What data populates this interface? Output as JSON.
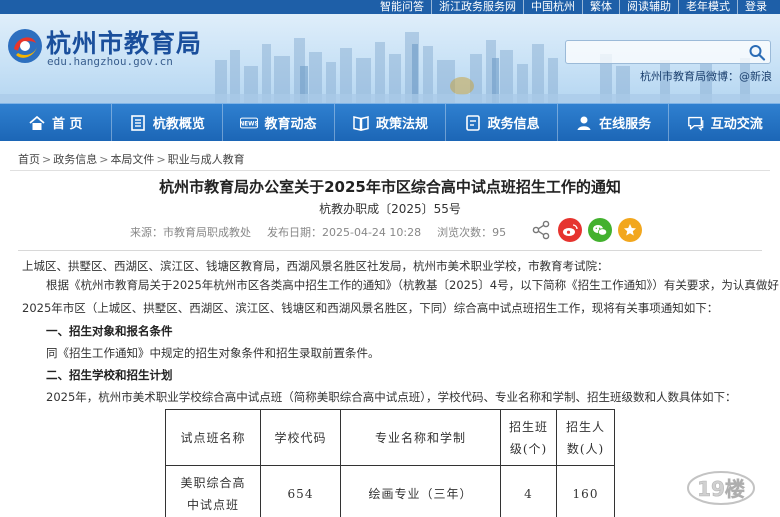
{
  "util_bar": {
    "links": [
      "智能问答",
      "浙江政务服务网",
      "中国杭州",
      "繁体",
      "阅读辅助",
      "老年模式",
      "登录"
    ]
  },
  "header": {
    "site_title": "杭州市教育局",
    "domain": "edu.hangzhou.gov.cn",
    "search_placeholder": "",
    "weibo_text": "杭州市教育局微博：@新浪"
  },
  "nav": {
    "items": [
      {
        "label": "首 页",
        "icon": "home-icon"
      },
      {
        "label": "杭教概览",
        "icon": "document-list-icon"
      },
      {
        "label": "教育动态",
        "icon": "news-icon"
      },
      {
        "label": "政策法规",
        "icon": "book-icon"
      },
      {
        "label": "政务信息",
        "icon": "info-doc-icon"
      },
      {
        "label": "在线服务",
        "icon": "person-icon"
      },
      {
        "label": "互动交流",
        "icon": "chat-icon"
      }
    ]
  },
  "breadcrumb": [
    "首页",
    "政务信息",
    "本局文件",
    "职业与成人教育"
  ],
  "article": {
    "title": "杭州市教育局办公室关于2025年市区综合高中试点班招生工作的通知",
    "doc_number": "杭教办职成〔2025〕55号",
    "source": "来源：市教育局职成教处",
    "publish_date": "发布日期：2025-04-24 10:28",
    "views": "浏览次数：95"
  },
  "share_icons": [
    "share-icon",
    "weibo-icon",
    "wechat-icon",
    "favorite-star-icon"
  ],
  "body": {
    "recipients": "上城区、拱墅区、西湖区、滨江区、钱塘区教育局，西湖风景名胜区社发局，杭州市美术职业学校，市教育考试院：",
    "para1_line1": "根据《杭州市教育局关于2025年杭州市区各类高中招生工作的通知》（杭教基〔2025〕4号，以下简称《招生工作通知》）有关要求，为认真做好",
    "para1_line2": "2025年市区（上城区、拱墅区、西湖区、滨江区、钱塘区和西湖风景名胜区，下同）综合高中试点班招生工作，现将有关事项通知如下：",
    "heading1": "一、招生对象和报名条件",
    "para2": "同《招生工作通知》中规定的招生对象条件和招生录取前置条件。",
    "heading2": "二、招生学校和招生计划",
    "para3": "2025年，杭州市美术职业学校综合高中试点班（简称美职综合高中试点班），学校代码、专业名称和学制、招生班级数和人数具体如下："
  },
  "table": {
    "headers": [
      "试点班名称",
      "学校代码",
      "专业名称和学制",
      "招生班\n级(个)",
      "招生人\n数(人)"
    ],
    "rows": [
      [
        "美职综合高\n中试点班",
        "654",
        "绘画专业（三年）",
        "4",
        "160"
      ]
    ]
  },
  "watermark": "19楼"
}
